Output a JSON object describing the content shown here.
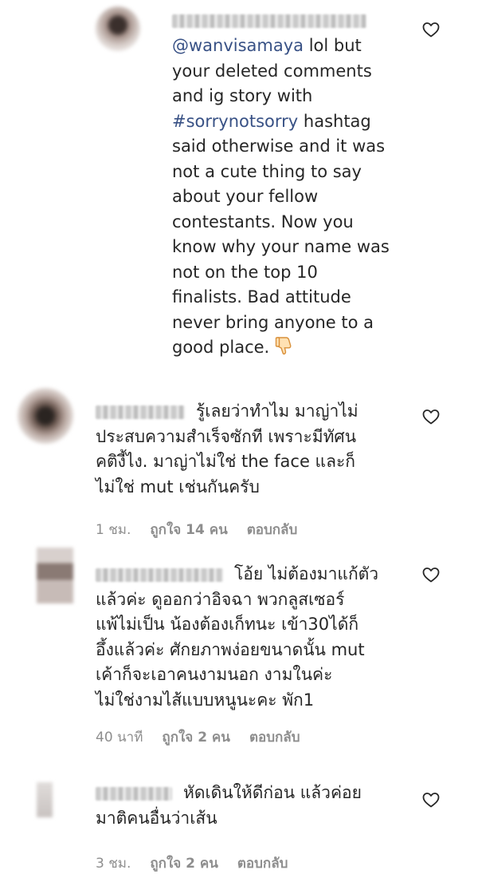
{
  "comments": [
    {
      "username_redacted": true,
      "mention": "@wanvisamaya",
      "text_after_mention": " lol but\nyour deleted comments\nand ig story with\n",
      "hashtag": "#sorrynotsorry",
      "text_after_hashtag": " hashtag\nsaid otherwise and it was\nnot a cute thing to say\nabout your fellow\ncontestants. Now you\nknow why your name was\nnot on the top 10\nfinalists. Bad attitude\nnever bring anyone to a\ngood place. ",
      "emoji": "thumbs-down"
    },
    {
      "username_redacted": true,
      "text": "รู้เลยว่าทำไม มาญ่าไม่\nประสบความสำเร็จซักที เพราะมีทัศน\nคติงี้ไง. มาญ่าไม่ใช่ the face และก็\nไม่ใช่ mut เช่นกันครับ",
      "time": "1 ชม.",
      "likes": "ถูกใจ 14 คน",
      "reply": "ตอบกลับ"
    },
    {
      "username_redacted": true,
      "text": "โอ้ย ไม่ต้องมาแก้ตัว\nแล้วค่ะ ดูออกว่าอิจฉา พวกลูสเซอร์\nแพ้ไม่เป็น น้องต้องเก็ทนะ เข้า30ได้ก็\nอึ้งแล้วค่ะ ศักยภาพง่อยขนาดนั้น mut\nเค้าก็จะเอาคนงามนอก งามในค่ะ\nไม่ใช่งามไส้แบบหนูนะคะ พัก1",
      "time": "40 นาที",
      "likes": "ถูกใจ 2 คน",
      "reply": "ตอบกลับ"
    },
    {
      "username_redacted": true,
      "text": "หัดเดินให้ดีก่อน แล้วค่อย\nมาติคนอื่นว่าเส้น",
      "time": "3 ชม.",
      "likes": "ถูกใจ 2 คน",
      "reply": "ตอบกลับ"
    }
  ],
  "colors": {
    "link": "#385185",
    "text": "#262626",
    "meta": "#8e8e8e"
  },
  "icons": {
    "like": "heart-outline-icon",
    "dislike": "thumbs-down-emoji"
  }
}
